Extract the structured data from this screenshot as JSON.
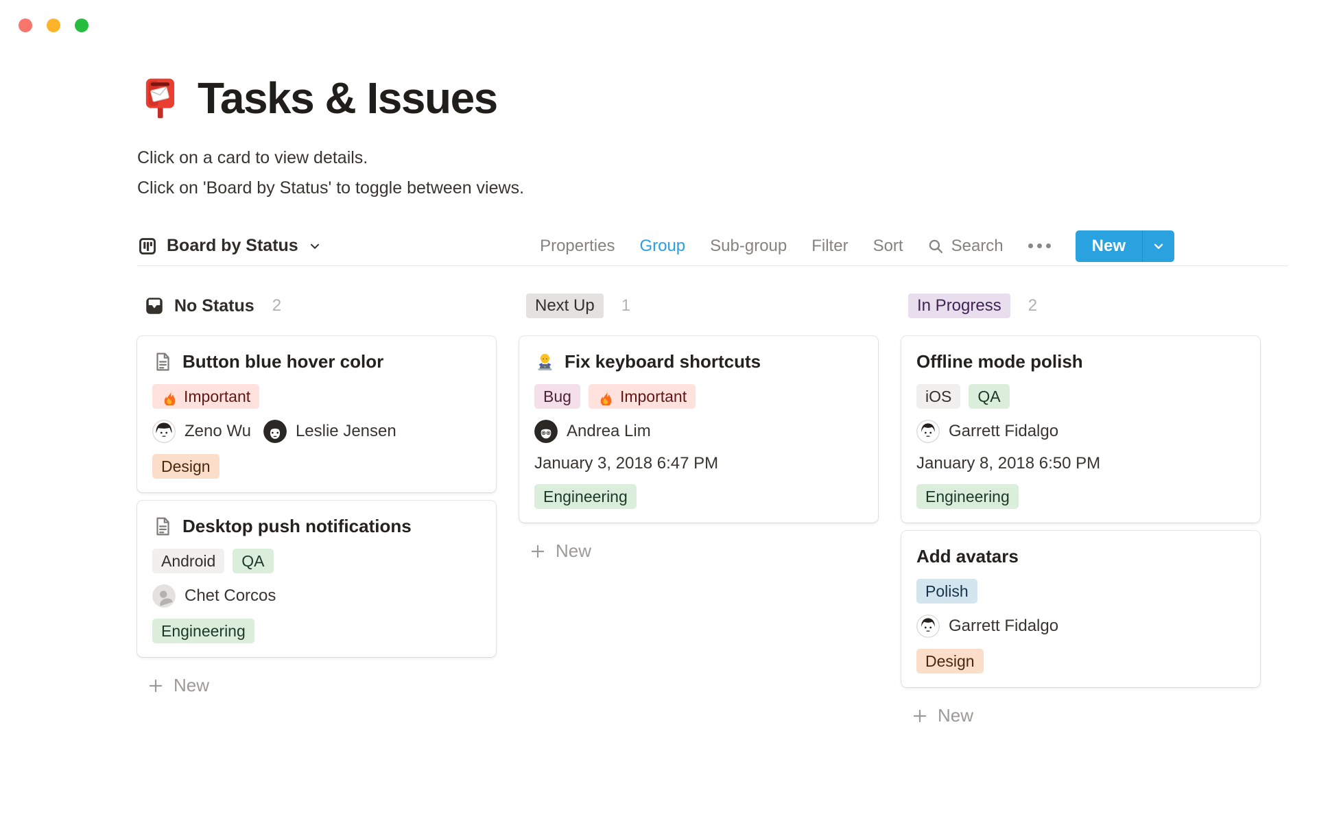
{
  "page": {
    "emoji_icon": "postbox-icon",
    "title": "Tasks & Issues",
    "subtitle_line1": "Click on a card to view details.",
    "subtitle_line2": "Click on 'Board by Status' to toggle between views."
  },
  "toolbar": {
    "view": {
      "icon": "board-icon",
      "label": "Board by Status"
    },
    "menu": [
      {
        "label": "Properties",
        "active": false
      },
      {
        "label": "Group",
        "active": true
      },
      {
        "label": "Sub-group",
        "active": false
      },
      {
        "label": "Filter",
        "active": false
      },
      {
        "label": "Sort",
        "active": false
      }
    ],
    "search_label": "Search",
    "more_icon": "ellipsis-icon",
    "new_label": "New"
  },
  "board": {
    "new_card_label": "New",
    "columns": [
      {
        "key": "no-status",
        "icon": "inbox-icon",
        "label": "No Status",
        "count": "2",
        "pill": null,
        "cards": [
          {
            "icon": "page-icon",
            "title": "Button blue hover color",
            "rows": [
              {
                "type": "tags",
                "tags": [
                  {
                    "label": "Important",
                    "color": "red",
                    "icon": "fire-icon"
                  }
                ]
              },
              {
                "type": "people",
                "people": [
                  {
                    "name": "Zeno Wu",
                    "avatar": "man-bowl"
                  },
                  {
                    "name": "Leslie Jensen",
                    "avatar": "woman-long"
                  }
                ]
              },
              {
                "type": "tags",
                "tags": [
                  {
                    "label": "Design",
                    "color": "orange"
                  }
                ]
              }
            ]
          },
          {
            "icon": "page-icon",
            "title": "Desktop push notifications",
            "rows": [
              {
                "type": "tags",
                "tags": [
                  {
                    "label": "Android",
                    "color": "lightgray"
                  },
                  {
                    "label": "QA",
                    "color": "green"
                  }
                ]
              },
              {
                "type": "people",
                "people": [
                  {
                    "name": "Chet Corcos",
                    "avatar": "generic"
                  }
                ]
              },
              {
                "type": "tags",
                "tags": [
                  {
                    "label": "Engineering",
                    "color": "green"
                  }
                ]
              }
            ]
          }
        ]
      },
      {
        "key": "next-up",
        "icon": null,
        "label": "Next Up",
        "count": "1",
        "pill": "gray",
        "cards": [
          {
            "icon": "technologist-icon",
            "title": "Fix keyboard shortcuts",
            "rows": [
              {
                "type": "tags",
                "tags": [
                  {
                    "label": "Bug",
                    "color": "pink"
                  },
                  {
                    "label": "Important",
                    "color": "red",
                    "icon": "fire-icon"
                  }
                ]
              },
              {
                "type": "people",
                "people": [
                  {
                    "name": "Andrea Lim",
                    "avatar": "woman-bob"
                  }
                ]
              },
              {
                "type": "date",
                "text": "January 3, 2018 6:47 PM"
              },
              {
                "type": "tags",
                "tags": [
                  {
                    "label": "Engineering",
                    "color": "green"
                  }
                ]
              }
            ]
          }
        ]
      },
      {
        "key": "in-progress",
        "icon": null,
        "label": "In Progress",
        "count": "2",
        "pill": "purple",
        "cards": [
          {
            "icon": null,
            "title": "Offline mode polish",
            "rows": [
              {
                "type": "tags",
                "tags": [
                  {
                    "label": "iOS",
                    "color": "lightgray"
                  },
                  {
                    "label": "QA",
                    "color": "green"
                  }
                ]
              },
              {
                "type": "people",
                "people": [
                  {
                    "name": "Garrett Fidalgo",
                    "avatar": "man-short"
                  }
                ]
              },
              {
                "type": "date",
                "text": "January 8, 2018 6:50 PM"
              },
              {
                "type": "tags",
                "tags": [
                  {
                    "label": "Engineering",
                    "color": "green"
                  }
                ]
              }
            ]
          },
          {
            "icon": null,
            "title": "Add avatars",
            "rows": [
              {
                "type": "tags",
                "tags": [
                  {
                    "label": "Polish",
                    "color": "blue"
                  }
                ]
              },
              {
                "type": "people",
                "people": [
                  {
                    "name": "Garrett Fidalgo",
                    "avatar": "man-short"
                  }
                ]
              },
              {
                "type": "tags",
                "tags": [
                  {
                    "label": "Design",
                    "color": "orange"
                  }
                ]
              }
            ]
          }
        ]
      }
    ]
  },
  "colors": {
    "accent_blue": "#2b9fe0",
    "traffic_lights": [
      "#f8756c",
      "#fdb32a",
      "#27bd3f"
    ],
    "tags": {
      "red": {
        "bg": "#ffe2dd",
        "text": "#5d1715"
      },
      "pink": {
        "bg": "#f5e0e9",
        "text": "#4c2337"
      },
      "orange": {
        "bg": "#fadec9",
        "text": "#49290e"
      },
      "green": {
        "bg": "#dbeddb",
        "text": "#1c3829"
      },
      "lightgray": {
        "bg": "#f1f0ef",
        "text": "#32302c"
      },
      "gray": {
        "bg": "#e3e2e0",
        "text": "#32302c"
      },
      "blue": {
        "bg": "#d3e5ef",
        "text": "#183347"
      },
      "purple": {
        "bg": "#e8deee",
        "text": "#412454"
      }
    }
  }
}
